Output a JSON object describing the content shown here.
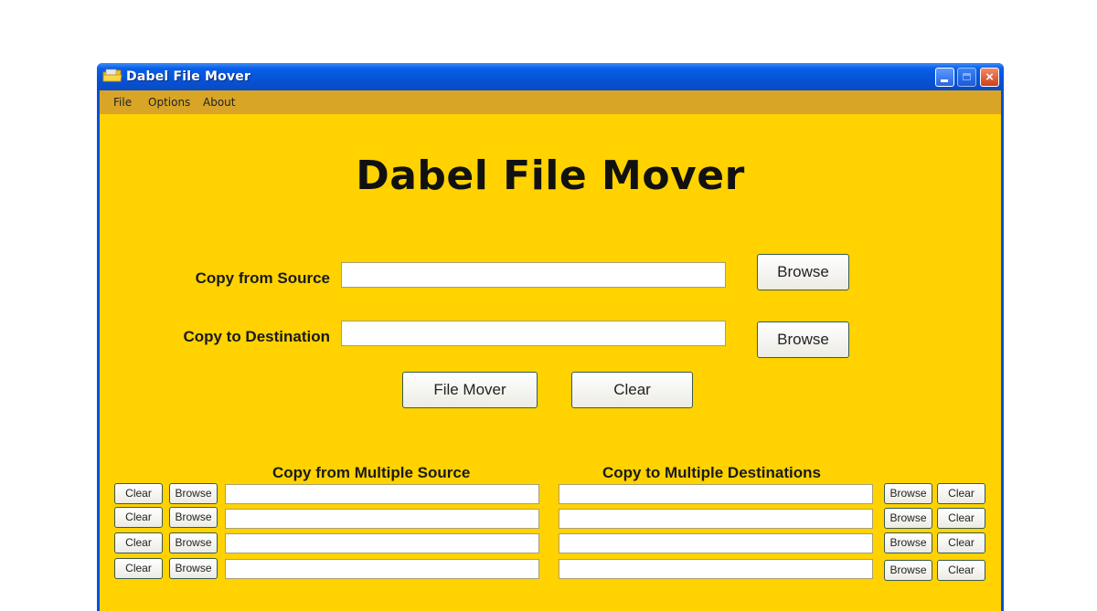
{
  "window": {
    "title": "Dabel File Mover",
    "icon": "folder-icon",
    "controls": {
      "minimize": "minimize",
      "maximize": "maximize",
      "close": "×"
    }
  },
  "menu": {
    "items": [
      "File",
      "Options",
      "About"
    ]
  },
  "main": {
    "heading": "Dabel File Mover",
    "source_label": "Copy from Source",
    "source_value": "",
    "destination_label": "Copy to Destination",
    "destination_value": "",
    "browse_label": "Browse",
    "file_mover_label": "File Mover",
    "clear_label": "Clear"
  },
  "multi_source": {
    "title": "Copy from Multiple Source",
    "clear_label": "Clear",
    "browse_label": "Browse",
    "rows": [
      "",
      "",
      "",
      ""
    ]
  },
  "multi_destination": {
    "title": "Copy to Multiple Destinations",
    "browse_label": "Browse",
    "clear_label": "Clear",
    "rows": [
      "",
      "",
      "",
      ""
    ]
  },
  "colors": {
    "client_background": "#ffd200",
    "menubar_background": "#d9a527",
    "titlebar": "#0653d6"
  }
}
